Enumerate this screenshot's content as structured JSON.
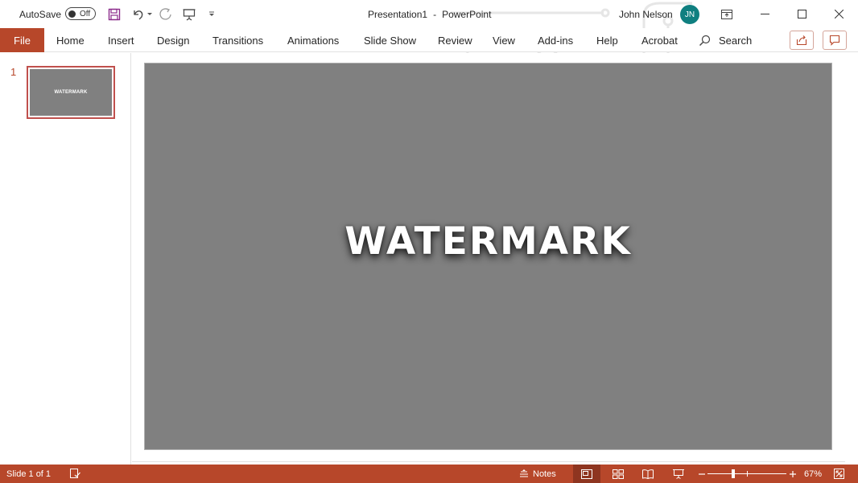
{
  "titlebar": {
    "autosave_label": "AutoSave",
    "autosave_state": "Off",
    "document_title": "Presentation1",
    "title_separator": "-",
    "app_name": "PowerPoint",
    "user_name": "John Nelson",
    "user_initials": "JN",
    "qat_icons": [
      "save-icon",
      "undo-icon",
      "redo-icon",
      "present-from-beginning-icon",
      "customize-qat-icon"
    ],
    "window_icons": [
      "ribbon-display-options-icon",
      "minimize-icon",
      "maximize-icon",
      "close-icon"
    ]
  },
  "ribbon": {
    "tabs": [
      {
        "label": "File",
        "key": "file"
      },
      {
        "label": "Home",
        "key": "home"
      },
      {
        "label": "Insert",
        "key": "insert"
      },
      {
        "label": "Design",
        "key": "design"
      },
      {
        "label": "Transitions",
        "key": "transitions"
      },
      {
        "label": "Animations",
        "key": "animations"
      },
      {
        "label": "Slide Show",
        "key": "slide-show"
      },
      {
        "label": "Review",
        "key": "review"
      },
      {
        "label": "View",
        "key": "view"
      },
      {
        "label": "Add-ins",
        "key": "add-ins"
      },
      {
        "label": "Help",
        "key": "help"
      },
      {
        "label": "Acrobat",
        "key": "acrobat"
      }
    ],
    "search_label": "Search",
    "right_buttons": [
      "share-icon",
      "comments-icon"
    ]
  },
  "thumbnails": [
    {
      "number": "1",
      "text": "WATERMARK",
      "selected": true
    }
  ],
  "slide": {
    "text": "WATERMARK",
    "background": "#808080",
    "text_color": "#ffffff"
  },
  "statusbar": {
    "slide_indicator": "Slide 1 of 1",
    "notes_label": "Notes",
    "zoom_level": "67%",
    "views": [
      "normal-view-icon",
      "slide-sorter-icon",
      "reading-view-icon",
      "slideshow-view-icon"
    ],
    "active_view": "normal-view-icon"
  },
  "colors": {
    "accent": "#b7472a",
    "accent_dark": "#8e3520",
    "avatar": "#0f7f80",
    "thumbnail_border": "#c0504d"
  }
}
